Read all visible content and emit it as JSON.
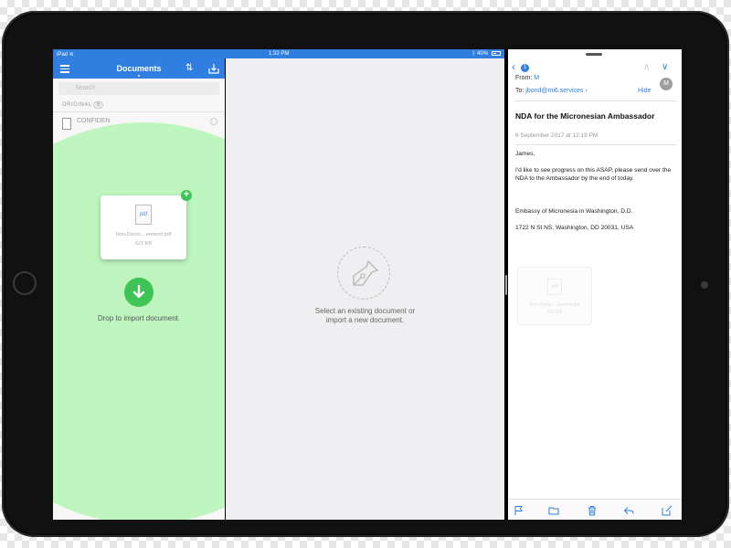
{
  "status_bar": {
    "device": "iPad",
    "time": "1:32 PM",
    "battery": "40%"
  },
  "documents_panel": {
    "title": "Documents",
    "search_placeholder": "Search",
    "section_label": "ORIGINAL",
    "section_count": "6",
    "file_row_name": "CONFIDEN",
    "drag_card": {
      "icon_label": "pdf",
      "file_name": "Non-Disclo... eement.pdf",
      "file_size": "621 KB"
    },
    "plus_label": "+",
    "drop_text": "Drop to import document."
  },
  "editor_panel": {
    "empty_line1": "Select an existing document or",
    "empty_line2": "import a new document."
  },
  "mail_panel": {
    "back_badge": "1",
    "from_label": "From:",
    "from_name": "M",
    "avatar_initial": "M",
    "to_label": "To:",
    "to_address": "jbond@mi6.services",
    "hide_label": "Hide",
    "subject": "NDA for the Micronesian Ambassador",
    "date": "6 September 2017 at 12:19 PM",
    "body": {
      "greeting": "James,",
      "paragraph": "I'd like to see progress on this ASAP, please send over the NDA to the Ambassador by the end of today.",
      "signature_line1": "Embassy of Micronesia in Washington, D.D.",
      "signature_line2": "1722 N St NS, Washington, DD 20031, USA"
    },
    "attachment": {
      "icon_label": "pdf",
      "file_name": "Non-Disclo... eement.pdf",
      "file_size": "621 KB"
    }
  },
  "colors": {
    "accent_blue": "#2f7ee0",
    "drop_green": "#3ec457",
    "drop_zone": "#b2f5b2"
  }
}
